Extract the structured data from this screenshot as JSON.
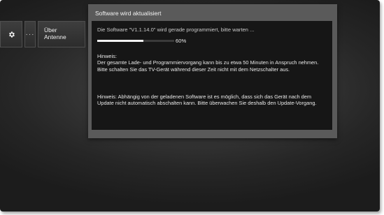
{
  "menu": {
    "items": [
      {
        "icon": "gear-icon"
      },
      {
        "label": "···"
      },
      {
        "label_line1": "Über",
        "label_line2": "Antenne"
      }
    ]
  },
  "dialog": {
    "title": "Software wird aktualisiert",
    "status": "Die Software \"V1.1.14.0\" wird gerade programmiert, bitte warten ...",
    "progress": {
      "percent": 60,
      "label": "60%"
    },
    "hint1": {
      "label": "Hinweis:",
      "text": "Der gesamte Lade- und Programmiervorgang kann bis zu etwa 50 Minuten in Anspruch nehmen. Bitte schalten Sie das TV-Gerät während dieser Zeit nicht mit dem Netzschalter aus."
    },
    "hint2": {
      "text": "Hinweis: Abhängig von der geladenen Software ist es möglich, dass sich das Gerät nach dem Update nicht automatisch abschalten kann. Bitte überwachen Sie deshalb den Update-Vorgang."
    }
  },
  "colors": {
    "background": "#2a2a2a",
    "dialog_frame": "#5a5a5a",
    "dialog_body": "#161616",
    "progress_fill": "#f2f2f2"
  }
}
